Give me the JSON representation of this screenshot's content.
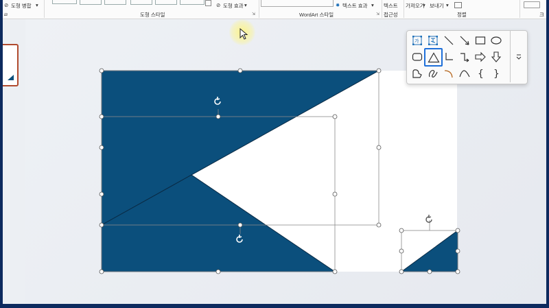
{
  "ribbon": {
    "merge_shapes": "도형 병합",
    "shape_styles_group": "도형 스타일",
    "shape_effects": "도형 효과",
    "wordart_group": "WordArt 스타일",
    "text_effects": "텍스트 효과",
    "text": "텍스트",
    "accessibility": "접근성",
    "bring_forward": "가져오기",
    "send_backward": "보내기",
    "arrange_group": "정렬",
    "size_group_partial": "크"
  },
  "colors": {
    "shape_fill": "#0b4f7c",
    "selection_accent": "#1e6fd9",
    "thumbnail_border": "#b04a2e"
  },
  "shape_gallery": {
    "items": [
      "text-box-horizontal-icon",
      "text-box-vertical-icon",
      "line-icon",
      "arrow-line-icon",
      "rectangle-icon",
      "oval-icon",
      "rounded-rectangle-icon",
      "triangle-icon",
      "elbow-connector-icon",
      "elbow-arrow-connector-icon",
      "right-arrow-icon",
      "down-arrow-icon",
      "freeform-shape-icon",
      "scribble-icon",
      "arc-icon",
      "curve-icon",
      "left-brace-icon",
      "right-brace-icon"
    ],
    "selected": "triangle-icon",
    "more": "gallery-more-icon"
  }
}
